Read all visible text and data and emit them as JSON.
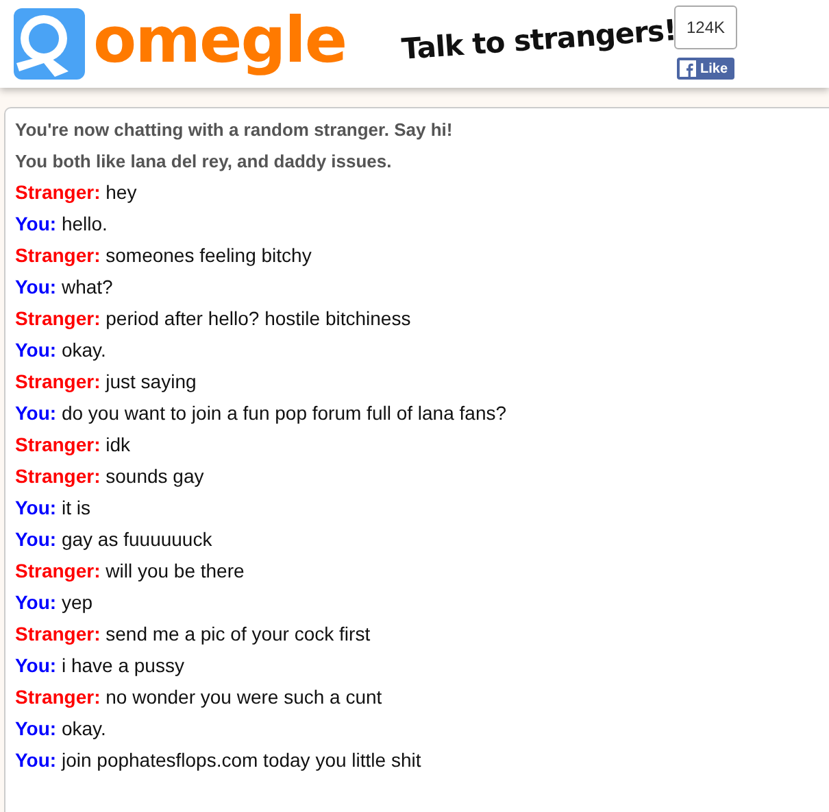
{
  "header": {
    "logo_text": "omegle",
    "tagline": "Talk to strangers!",
    "like_count": "124K",
    "like_button": "Like"
  },
  "chat": {
    "notices": [
      "You're now chatting with a random stranger. Say hi!",
      "You both like lana del rey, and daddy issues."
    ],
    "messages": [
      {
        "kind": "stranger",
        "sender": "Stranger:",
        "text": "hey"
      },
      {
        "kind": "you",
        "sender": "You:",
        "text": "hello."
      },
      {
        "kind": "stranger",
        "sender": "Stranger:",
        "text": "someones feeling bitchy"
      },
      {
        "kind": "you",
        "sender": "You:",
        "text": "what?"
      },
      {
        "kind": "stranger",
        "sender": "Stranger:",
        "text": "period after hello? hostile bitchiness"
      },
      {
        "kind": "you",
        "sender": "You:",
        "text": "okay."
      },
      {
        "kind": "stranger",
        "sender": "Stranger:",
        "text": "just saying"
      },
      {
        "kind": "you",
        "sender": "You:",
        "text": "do you want to join a fun pop forum full of lana fans?"
      },
      {
        "kind": "stranger",
        "sender": "Stranger:",
        "text": "idk"
      },
      {
        "kind": "stranger",
        "sender": "Stranger:",
        "text": "sounds gay"
      },
      {
        "kind": "you",
        "sender": "You:",
        "text": "it is"
      },
      {
        "kind": "you",
        "sender": "You:",
        "text": "gay as fuuuuuuck"
      },
      {
        "kind": "stranger",
        "sender": "Stranger:",
        "text": "will you be there"
      },
      {
        "kind": "you",
        "sender": "You:",
        "text": "yep"
      },
      {
        "kind": "stranger",
        "sender": "Stranger:",
        "text": "send me a pic of your cock first"
      },
      {
        "kind": "you",
        "sender": "You:",
        "text": "i have a pussy"
      },
      {
        "kind": "stranger",
        "sender": "Stranger:",
        "text": "no wonder you were such a cunt"
      },
      {
        "kind": "you",
        "sender": "You:",
        "text": "okay."
      },
      {
        "kind": "you",
        "sender": "You:",
        "text": "join pophatesflops.com today you little shit"
      }
    ]
  }
}
